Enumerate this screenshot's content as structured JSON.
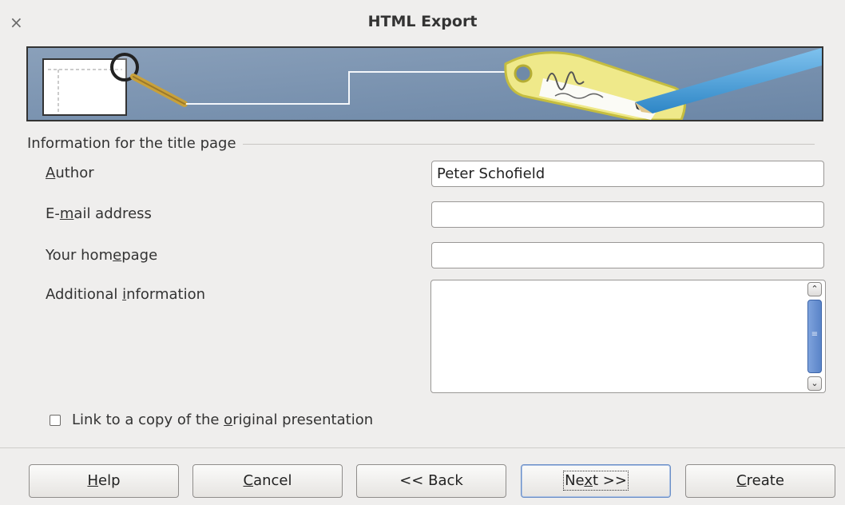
{
  "window": {
    "title": "HTML Export",
    "close_glyph": "×"
  },
  "banner": {
    "icon": "html-export-wizard-banner"
  },
  "section": {
    "title": "Information for the title page"
  },
  "fields": {
    "author": {
      "label_pre": "",
      "label_key": "A",
      "label_post": "uthor",
      "value": "Peter Schofield"
    },
    "email": {
      "label_pre": "E-",
      "label_key": "m",
      "label_post": "ail address",
      "value": ""
    },
    "homepage": {
      "label_pre": "Your hom",
      "label_key": "e",
      "label_post": "page",
      "value": ""
    },
    "info": {
      "label_pre": "Additional ",
      "label_key": "i",
      "label_post": "nformation",
      "value": ""
    }
  },
  "link_checkbox": {
    "label_pre": "Link to a copy of the ",
    "label_key": "o",
    "label_post": "riginal presentation",
    "checked": false
  },
  "buttons": {
    "help": {
      "key": "H",
      "rest": "elp"
    },
    "cancel": {
      "key": "C",
      "rest": "ancel"
    },
    "back": {
      "label": "<< Back"
    },
    "next": {
      "pre": "Ne",
      "key": "x",
      "rest": "t >>"
    },
    "create": {
      "key": "C",
      "rest": "reate"
    }
  },
  "colors": {
    "accent": "#5a84c8",
    "banner_bg": "#6f8aa8"
  }
}
